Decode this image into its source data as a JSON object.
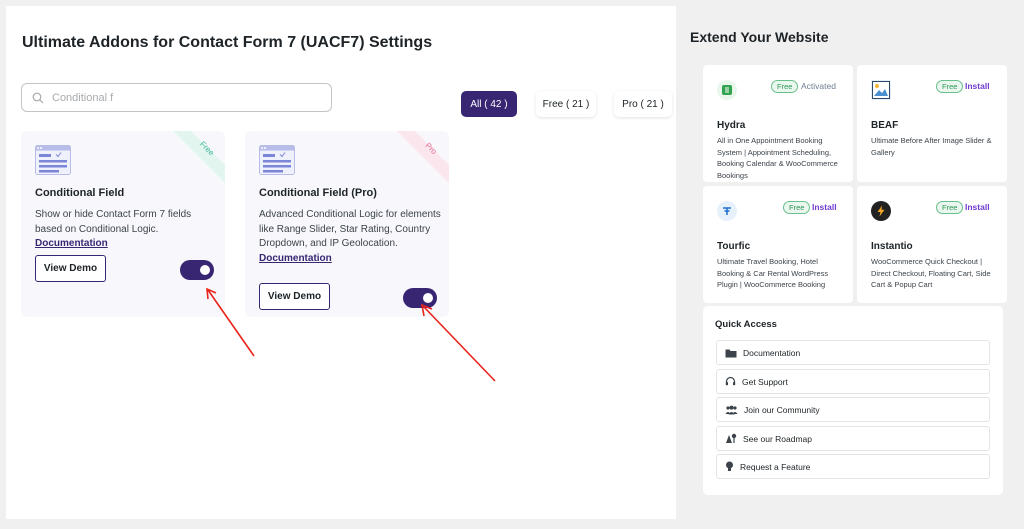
{
  "page_title": "Ultimate Addons for Contact Form 7 (UACF7) Settings",
  "search": {
    "value": "Conditional f"
  },
  "filters": {
    "all": "All ( 42 )",
    "free": "Free ( 21 )",
    "pro": "Pro ( 21 )"
  },
  "addons": [
    {
      "ribbon": "Free",
      "title": "Conditional Field",
      "description": "Show or hide Contact Form 7 fields based on Conditional Logic.",
      "doc_link": "Documentation",
      "demo_label": "View Demo",
      "enabled": true
    },
    {
      "ribbon": "Pro",
      "title": "Conditional Field (Pro)",
      "description": "Advanced Conditional Logic for elements like Range Slider, Star Rating, Country Dropdown, and IP Geolocation.",
      "doc_link": "Documentation",
      "demo_label": "View Demo",
      "enabled": true
    }
  ],
  "sidebar": {
    "title": "Extend Your Website",
    "plugins": [
      {
        "name": "Hydra",
        "badge": "Free",
        "status": "Activated",
        "description": "All in One Appointment Booking System | Appointment Scheduling, Booking Calendar & WooCommerce Bookings",
        "icon": "hydra-icon"
      },
      {
        "name": "BEAF",
        "badge": "Free",
        "status": "Install",
        "description": "Ultimate Before After Image Slider & Gallery",
        "icon": "beaf-icon"
      },
      {
        "name": "Tourfic",
        "badge": "Free",
        "status": "Install",
        "description": "Ultimate Travel Booking, Hotel Booking & Car Rental WordPress Plugin | WooCommerce Booking",
        "icon": "tourfic-icon"
      },
      {
        "name": "Instantio",
        "badge": "Free",
        "status": "Install",
        "description": "WooCommerce Quick Checkout | Direct Checkout, Floating Cart, Side Cart & Popup Cart",
        "icon": "lightning-icon"
      }
    ],
    "quick_access": {
      "title": "Quick Access",
      "items": [
        {
          "label": "Documentation",
          "icon": "folder-icon"
        },
        {
          "label": "Get Support",
          "icon": "headset-icon"
        },
        {
          "label": "Join our Community",
          "icon": "users-icon"
        },
        {
          "label": "See our Roadmap",
          "icon": "roadmap-icon"
        },
        {
          "label": "Request a Feature",
          "icon": "lightbulb-icon"
        }
      ]
    }
  },
  "colors": {
    "primary": "#382673",
    "free_badge": "#2e9656",
    "install_link": "#6f3bd0",
    "pro_ribbon": "#e46d8f",
    "free_ribbon": "#3ab89a",
    "annotation_arrow": "#e8231a"
  }
}
